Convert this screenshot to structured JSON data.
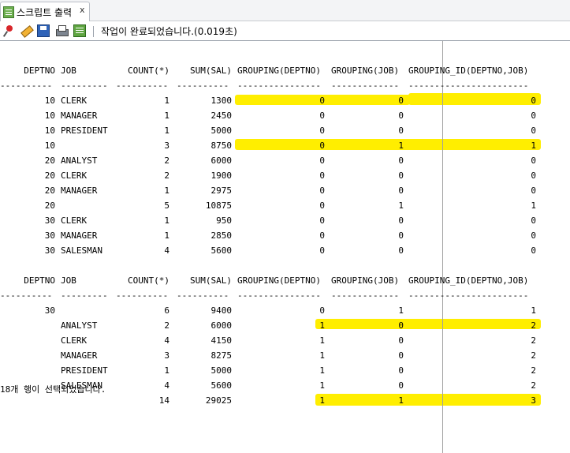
{
  "tab": {
    "label": "스크립트 출력",
    "close": "x",
    "icon": "script-output-icon"
  },
  "toolbar": {
    "icons": [
      "pin-icon",
      "eraser-icon",
      "save-icon",
      "print-icon",
      "run-script-icon"
    ],
    "status": "작업이 완료되었습니다.(0.019초)"
  },
  "highlight_color": "#ffee00",
  "results": [
    {
      "columns": [
        "DEPTNO",
        "JOB",
        "COUNT(*)",
        "SUM(SAL)",
        "GROUPING(DEPTNO)",
        "GROUPING(JOB)",
        "GROUPING_ID(DEPTNO,JOB)"
      ],
      "separator": [
        "----------",
        "---------",
        "----------",
        "----------",
        "----------------",
        "-------------",
        "-----------------------"
      ],
      "rows": [
        [
          "10",
          "CLERK",
          "1",
          "1300",
          "0",
          "0",
          "0"
        ],
        [
          "10",
          "MANAGER",
          "1",
          "2450",
          "0",
          "0",
          "0"
        ],
        [
          "10",
          "PRESIDENT",
          "1",
          "5000",
          "0",
          "0",
          "0"
        ],
        [
          "10",
          "",
          "3",
          "8750",
          "0",
          "1",
          "1"
        ],
        [
          "20",
          "ANALYST",
          "2",
          "6000",
          "0",
          "0",
          "0"
        ],
        [
          "20",
          "CLERK",
          "2",
          "1900",
          "0",
          "0",
          "0"
        ],
        [
          "20",
          "MANAGER",
          "1",
          "2975",
          "0",
          "0",
          "0"
        ],
        [
          "20",
          "",
          "5",
          "10875",
          "0",
          "1",
          "1"
        ],
        [
          "30",
          "CLERK",
          "1",
          "950",
          "0",
          "0",
          "0"
        ],
        [
          "30",
          "MANAGER",
          "1",
          "2850",
          "0",
          "0",
          "0"
        ],
        [
          "30",
          "SALESMAN",
          "4",
          "5600",
          "0",
          "0",
          "0"
        ]
      ]
    },
    {
      "columns": [
        "DEPTNO",
        "JOB",
        "COUNT(*)",
        "SUM(SAL)",
        "GROUPING(DEPTNO)",
        "GROUPING(JOB)",
        "GROUPING_ID(DEPTNO,JOB)"
      ],
      "separator": [
        "----------",
        "---------",
        "----------",
        "----------",
        "----------------",
        "-------------",
        "-----------------------"
      ],
      "rows": [
        [
          "30",
          "",
          "6",
          "9400",
          "0",
          "1",
          "1"
        ],
        [
          "",
          "ANALYST",
          "2",
          "6000",
          "1",
          "0",
          "2"
        ],
        [
          "",
          "CLERK",
          "4",
          "4150",
          "1",
          "0",
          "2"
        ],
        [
          "",
          "MANAGER",
          "3",
          "8275",
          "1",
          "0",
          "2"
        ],
        [
          "",
          "PRESIDENT",
          "1",
          "5000",
          "1",
          "0",
          "2"
        ],
        [
          "",
          "SALESMAN",
          "4",
          "5600",
          "1",
          "0",
          "2"
        ],
        [
          "",
          "",
          "14",
          "29025",
          "1",
          "1",
          "3"
        ]
      ]
    }
  ],
  "footer": "18개 행이 선택되었습니다."
}
